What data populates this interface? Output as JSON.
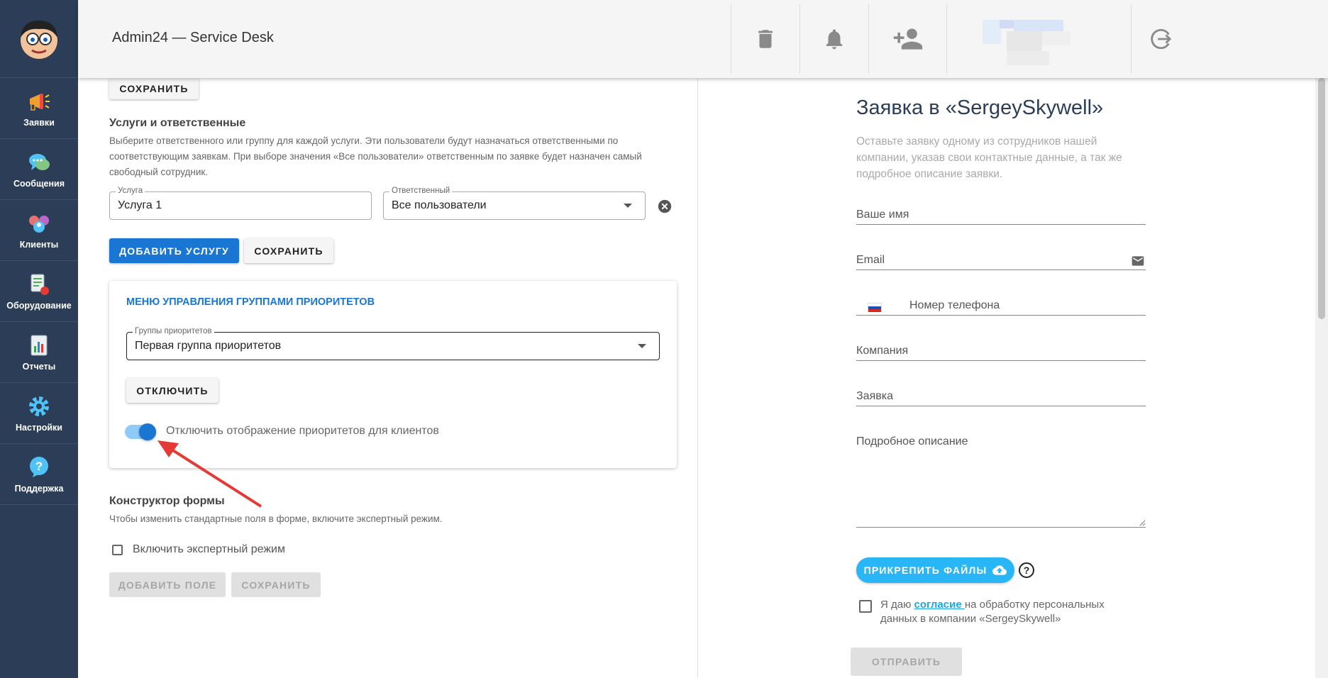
{
  "header": {
    "title": "Admin24 — Service Desk"
  },
  "sidebar": {
    "items": [
      {
        "label": "Заявки",
        "icon": "megaphone-icon"
      },
      {
        "label": "Сообщения",
        "icon": "chat-bubbles-icon"
      },
      {
        "label": "Клиенты",
        "icon": "clients-icon"
      },
      {
        "label": "Оборудование",
        "icon": "equipment-icon"
      },
      {
        "label": "Отчеты",
        "icon": "reports-icon"
      },
      {
        "label": "Настройки",
        "icon": "gear-icon"
      },
      {
        "label": "Поддержка",
        "icon": "help-icon"
      }
    ]
  },
  "left": {
    "top_save_label": "СОХРАНИТЬ",
    "services": {
      "title": "Услуги и ответственные",
      "description": "Выберите ответственного или группу для каждой услуги. Эти пользователи будут назначаться ответственными по соответствующим заявкам. При выборе значения «Все пользователи» ответственным по заявке будет назначен самый свободный сотрудник.",
      "service_label": "Услуга",
      "service_value": "Услуга 1",
      "responsible_label": "Ответственный",
      "responsible_value": "Все пользователи",
      "add_service_label": "ДОБАВИТЬ УСЛУГУ",
      "save_label": "СОХРАНИТЬ"
    },
    "priority": {
      "title": "МЕНЮ УПРАВЛЕНИЯ ГРУППАМИ ПРИОРИТЕТОВ",
      "group_label": "Группы приоритетов",
      "group_value": "Первая группа приоритетов",
      "disable_label": "ОТКЛЮЧИТЬ",
      "toggle_label": "Отключить отображение приоритетов для клиентов",
      "toggle_on": true
    },
    "constructor": {
      "title": "Конструктор формы",
      "description": "Чтобы изменить стандартные поля в форме, включите экспертный режим.",
      "expert_label": "Включить экспертный режим",
      "add_field_label": "ДОБАВИТЬ ПОЛЕ",
      "save_label": "СОХРАНИТЬ"
    }
  },
  "form": {
    "title": "Заявка в «SergeySkywell»",
    "description": "Оставьте заявку одному из сотрудников нашей компании, указав свои контактные данные, а так же подробное описание заявки.",
    "name_placeholder": "Ваше имя",
    "email_placeholder": "Email",
    "phone_placeholder": "Номер телефона",
    "company_placeholder": "Компания",
    "request_placeholder": "Заявка",
    "details_placeholder": "Подробное описание",
    "attach_label": "ПРИКРЕПИТЬ ФАЙЛЫ",
    "consent_prefix": "Я даю ",
    "consent_link": "согласие ",
    "consent_suffix": "на обработку персональных данных в компании «SergeySkywell»",
    "submit_label": "ОТПРАВИТЬ"
  },
  "colors": {
    "sidebar": "#2c3e57",
    "primary": "#1976d2",
    "attach": "#29b6f6",
    "arrow": "#e53935"
  }
}
